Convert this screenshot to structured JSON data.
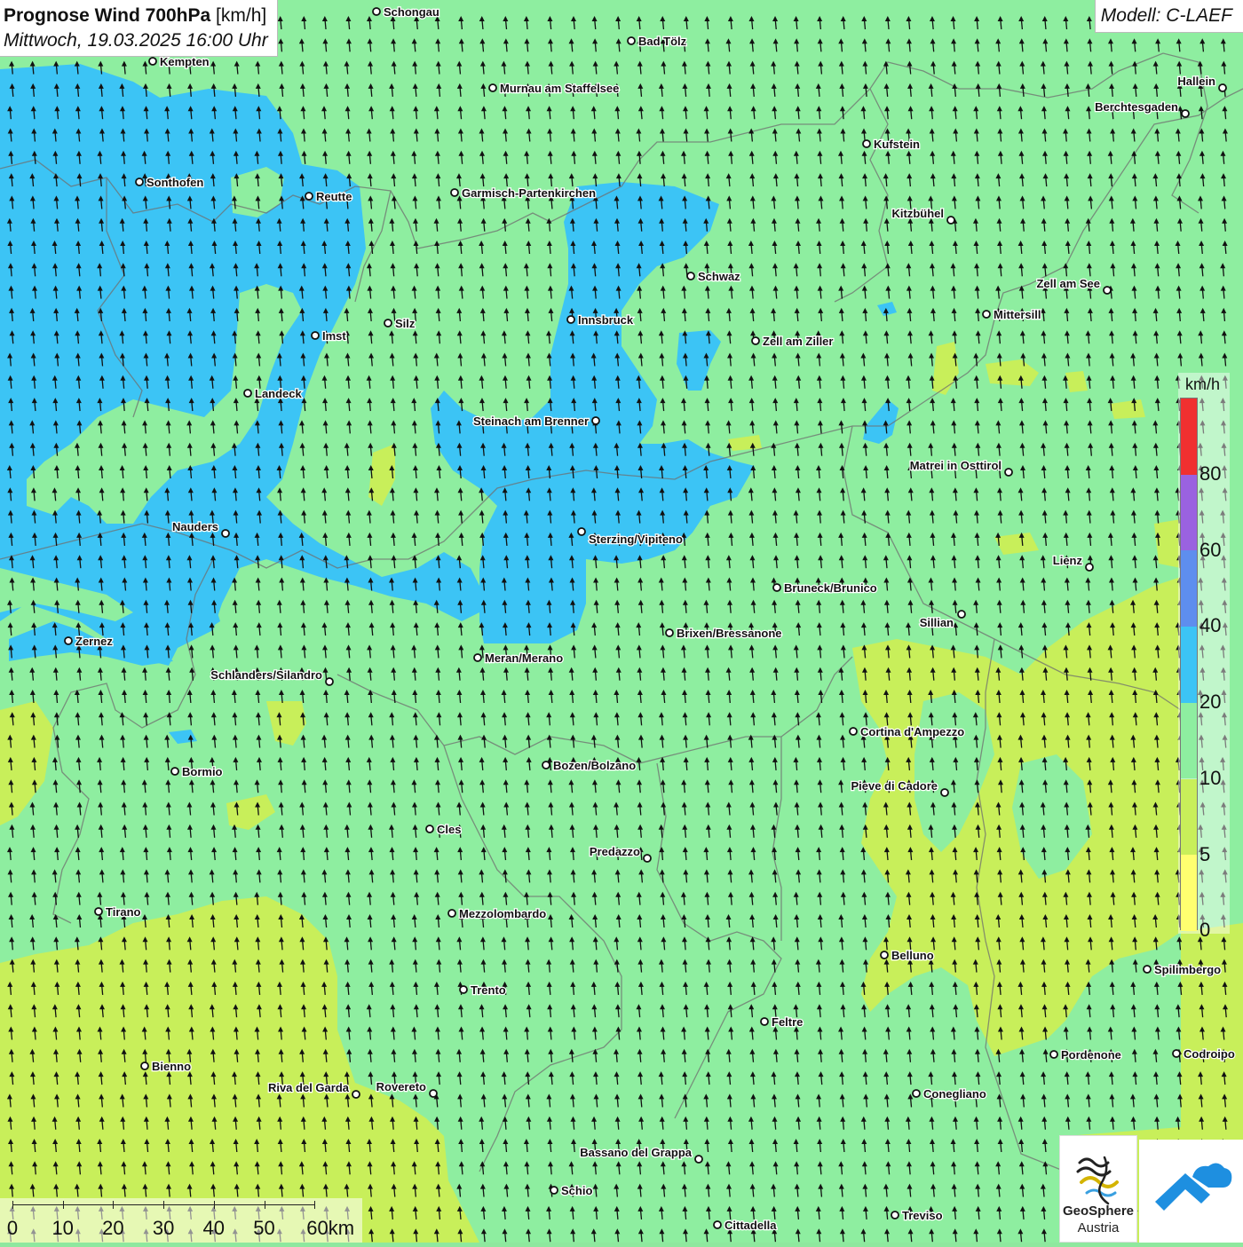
{
  "header": {
    "title_bold": "Prognose Wind 700hPa",
    "title_unit": "[km/h]",
    "datetime": "Mittwoch, 19.03.2025 16:00 Uhr",
    "model": "Modell: C-LAEF"
  },
  "legend": {
    "unit": "km/h",
    "colors": {
      "0": "#ffff70",
      "5": "#c8ef5a",
      "10": "#8eeea0",
      "20": "#3cc4f5",
      "40": "#5e8eee",
      "60": "#9a62e0",
      "80": "#f03030"
    },
    "ticks": [
      "80",
      "60",
      "40",
      "20",
      "10",
      "5",
      "0"
    ]
  },
  "scale_bar": {
    "labels": [
      "0",
      "10",
      "20",
      "30",
      "40",
      "50",
      "60km"
    ]
  },
  "logos": {
    "geosphere_line1": "GeoSphere",
    "geosphere_line2": "Austria"
  },
  "wind": {
    "direction": "north",
    "arrow_icon": "wind-arrow-icon"
  },
  "cities": [
    {
      "name": "Schongau"
    },
    {
      "name": "Bad Tölz"
    },
    {
      "name": "Kempten"
    },
    {
      "name": "Murnau am Staffelsee"
    },
    {
      "name": "Hallein"
    },
    {
      "name": "Berchtesgaden"
    },
    {
      "name": "Kufstein"
    },
    {
      "name": "Sonthofen"
    },
    {
      "name": "Reutte"
    },
    {
      "name": "Garmisch-Partenkirchen"
    },
    {
      "name": "Kitzbühel"
    },
    {
      "name": "Schwaz"
    },
    {
      "name": "Zell am See"
    },
    {
      "name": "Mittersill"
    },
    {
      "name": "Silz"
    },
    {
      "name": "Innsbruck"
    },
    {
      "name": "Imst"
    },
    {
      "name": "Zell am Ziller"
    },
    {
      "name": "Landeck"
    },
    {
      "name": "Steinach am Brenner"
    },
    {
      "name": "Matrei in Osttirol"
    },
    {
      "name": "Nauders"
    },
    {
      "name": "Sterzing/Vipiteno"
    },
    {
      "name": "Lienz"
    },
    {
      "name": "Bruneck/Brunico"
    },
    {
      "name": "Sillian"
    },
    {
      "name": "Brixen/Bressanone"
    },
    {
      "name": "Zernez"
    },
    {
      "name": "Meran/Merano"
    },
    {
      "name": "Schlanders/Silandro"
    },
    {
      "name": "Cortina d'Ampezzo"
    },
    {
      "name": "Bozen/Bolzano"
    },
    {
      "name": "Bormio"
    },
    {
      "name": "Pieve di Cadore"
    },
    {
      "name": "Cles"
    },
    {
      "name": "Predazzo"
    },
    {
      "name": "Tirano"
    },
    {
      "name": "Mezzolombardo"
    },
    {
      "name": "Belluno"
    },
    {
      "name": "Spilimbergo"
    },
    {
      "name": "Trento"
    },
    {
      "name": "Feltre"
    },
    {
      "name": "Pordenone"
    },
    {
      "name": "Codroipo"
    },
    {
      "name": "Bienno"
    },
    {
      "name": "Riva del Garda"
    },
    {
      "name": "Rovereto"
    },
    {
      "name": "Conegliano"
    },
    {
      "name": "Bassano del Grappa"
    },
    {
      "name": "Schio"
    },
    {
      "name": "Treviso"
    },
    {
      "name": "Cittadella"
    }
  ]
}
